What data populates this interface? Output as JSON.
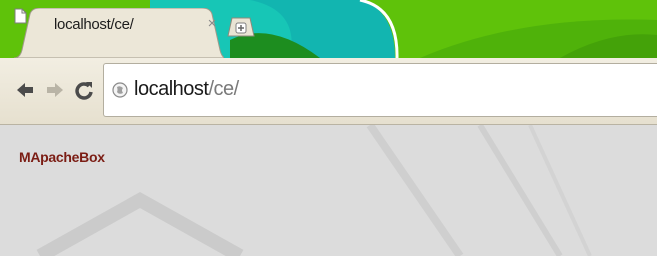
{
  "browser": {
    "tab": {
      "title": "localhost/ce/",
      "close_glyph": "×"
    },
    "new_tab": {
      "icon": "new-tab-icon"
    },
    "toolbar": {
      "back_icon": "back-arrow-icon",
      "forward_icon": "forward-arrow-icon",
      "reload_icon": "reload-icon"
    },
    "address_bar": {
      "host": "localhost",
      "path": "/ce/",
      "page_icon": "page-info-icon"
    },
    "theme_colors": {
      "primary": "#5fc20a",
      "accent": "#12b5b0",
      "chrome": "#ece7d8"
    }
  },
  "page": {
    "site_link": "MApacheBox",
    "link_color": "#7b1d14",
    "background": "#dcdcdc"
  }
}
